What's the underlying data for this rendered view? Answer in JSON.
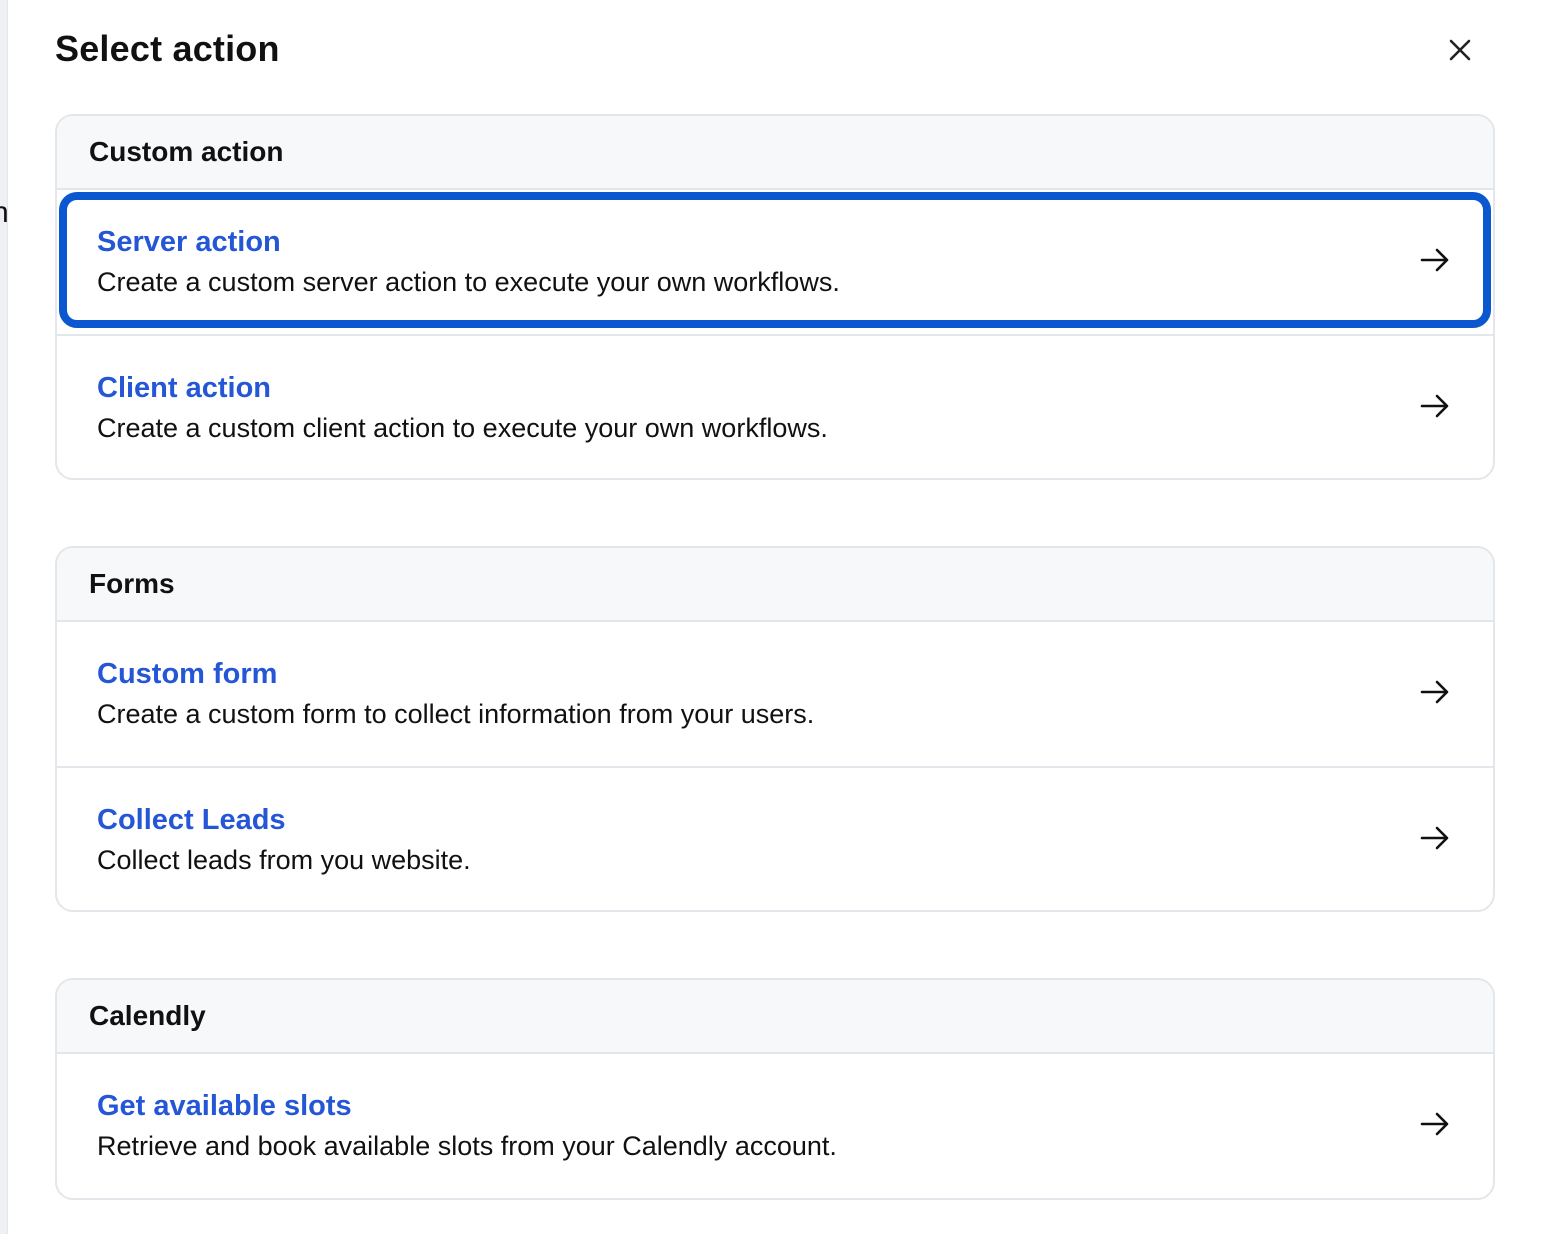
{
  "dialog": {
    "title": "Select action",
    "close_icon": "close-icon"
  },
  "sections": [
    {
      "header": "Custom action",
      "items": [
        {
          "title": "Server action",
          "description": "Create a custom server action to execute your own workflows.",
          "icon": "arrow-right-icon",
          "focused": true
        },
        {
          "title": "Client action",
          "description": "Create a custom client action to execute your own workflows.",
          "icon": "arrow-right-icon"
        }
      ]
    },
    {
      "header": "Forms",
      "items": [
        {
          "title": "Custom form",
          "description": "Create a custom form to collect information from your users.",
          "icon": "arrow-right-icon"
        },
        {
          "title": "Collect Leads",
          "description": "Collect leads from you website.",
          "icon": "arrow-right-icon"
        }
      ]
    },
    {
      "header": "Calendly",
      "items": [
        {
          "title": "Get available slots",
          "description": "Retrieve and book available slots from your Calendly account.",
          "icon": "arrow-right-icon"
        }
      ]
    }
  ],
  "colors": {
    "link_blue": "#2456d6",
    "focus_ring": "#0a57d0",
    "header_bg": "#f6f8fa",
    "border": "#e3e6ea"
  }
}
